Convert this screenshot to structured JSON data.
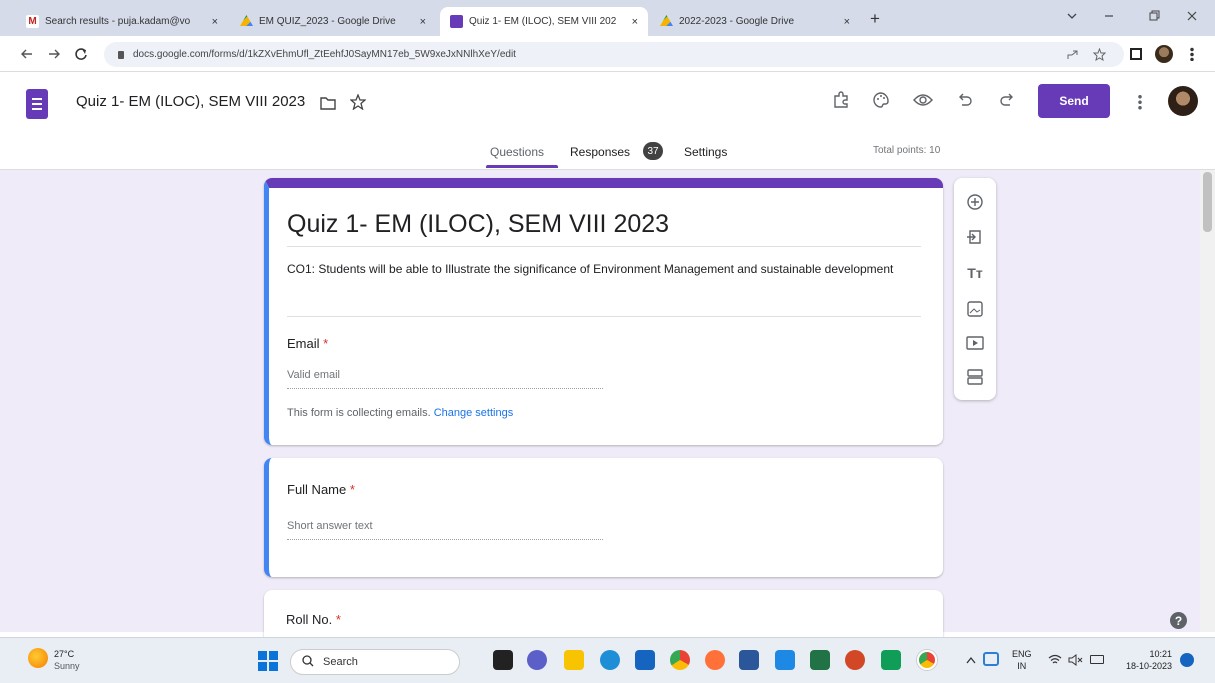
{
  "browser": {
    "tabs": [
      {
        "title": "Search results - puja.kadam@vo",
        "color": "#c5221f"
      },
      {
        "title": "EM QUIZ_2023 - Google Drive",
        "color": "#1a73e8"
      },
      {
        "title": "Quiz 1- EM (ILOC), SEM VIII 202",
        "color": "#673ab7"
      },
      {
        "title": "2022-2023 - Google Drive",
        "color": "#1a73e8"
      }
    ],
    "close_glyph": "×",
    "new_tab_glyph": "+",
    "url": "docs.google.com/forms/d/1kZXvEhmUfl_ZtEehfJ0SayMN17eb_5W9xeJxNNlhXeY/edit"
  },
  "app": {
    "form_title": "Quiz 1- EM (ILOC), SEM VIII 2023",
    "send_label": "Send",
    "tabs": {
      "questions": "Questions",
      "responses": "Responses",
      "responses_count": "37",
      "settings": "Settings"
    },
    "total_points": "Total points: 10",
    "accent": "#673ab7"
  },
  "form": {
    "title": "Quiz 1- EM (ILOC), SEM VIII 2023",
    "description": "CO1: Students will be able to Illustrate the significance of Environment Management and sustainable development",
    "email": {
      "label": "Email",
      "required_mark": "*",
      "placeholder": "Valid email",
      "note": "This form is collecting emails.",
      "link": "Change settings"
    },
    "questions": [
      {
        "title": "Full Name",
        "required_mark": "*",
        "placeholder": "Short answer text"
      },
      {
        "title": "Roll No.",
        "required_mark": "*"
      }
    ]
  },
  "sidebar_tools": {
    "text_icon_glyph": "Tт"
  },
  "help_glyph": "?",
  "taskbar": {
    "weather_temp": "27°C",
    "weather_desc": "Sunny",
    "search": "Search",
    "lang": "ENG",
    "region": "IN",
    "time": "10:21",
    "date": "18-10-2023"
  }
}
